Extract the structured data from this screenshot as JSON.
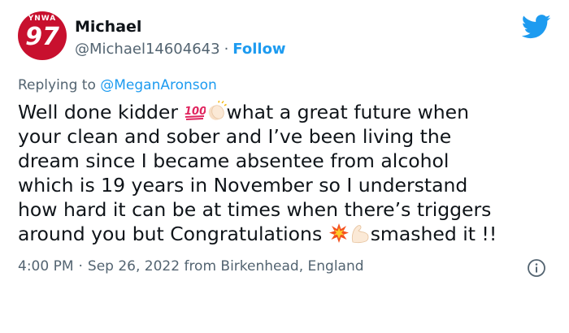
{
  "user": {
    "name": "Michael",
    "handle": "@Michael14604643",
    "separator": "·",
    "follow_label": "Follow",
    "avatar_top_text": "YNWA",
    "avatar_number": "97"
  },
  "reply": {
    "prefix": "Replying to ",
    "mention": "@MeganAronson"
  },
  "tweet": {
    "line1_start": "Well done kidder",
    "line1_end": "what a great future when",
    "line2": "your clean and sober and I’ve been living the",
    "line3": "dream since I became absentee from alcohol",
    "line4": "which is 19 years in November so I understand",
    "line5": "how hard it can be at times when there’s triggers",
    "line6_start": "around you but Congratulations",
    "line6_end": "smashed it !!",
    "emojis": [
      "hundred-points-icon",
      "clapping-hands-icon",
      "collision-icon",
      "flexed-biceps-icon"
    ]
  },
  "meta": {
    "time": "4:00 PM",
    "separator": "·",
    "date_location": "Sep 26, 2022 from Birkenhead, England"
  },
  "colors": {
    "accent": "#1d9bf0",
    "secondary_text": "#536471",
    "avatar_red": "#c8102e"
  }
}
